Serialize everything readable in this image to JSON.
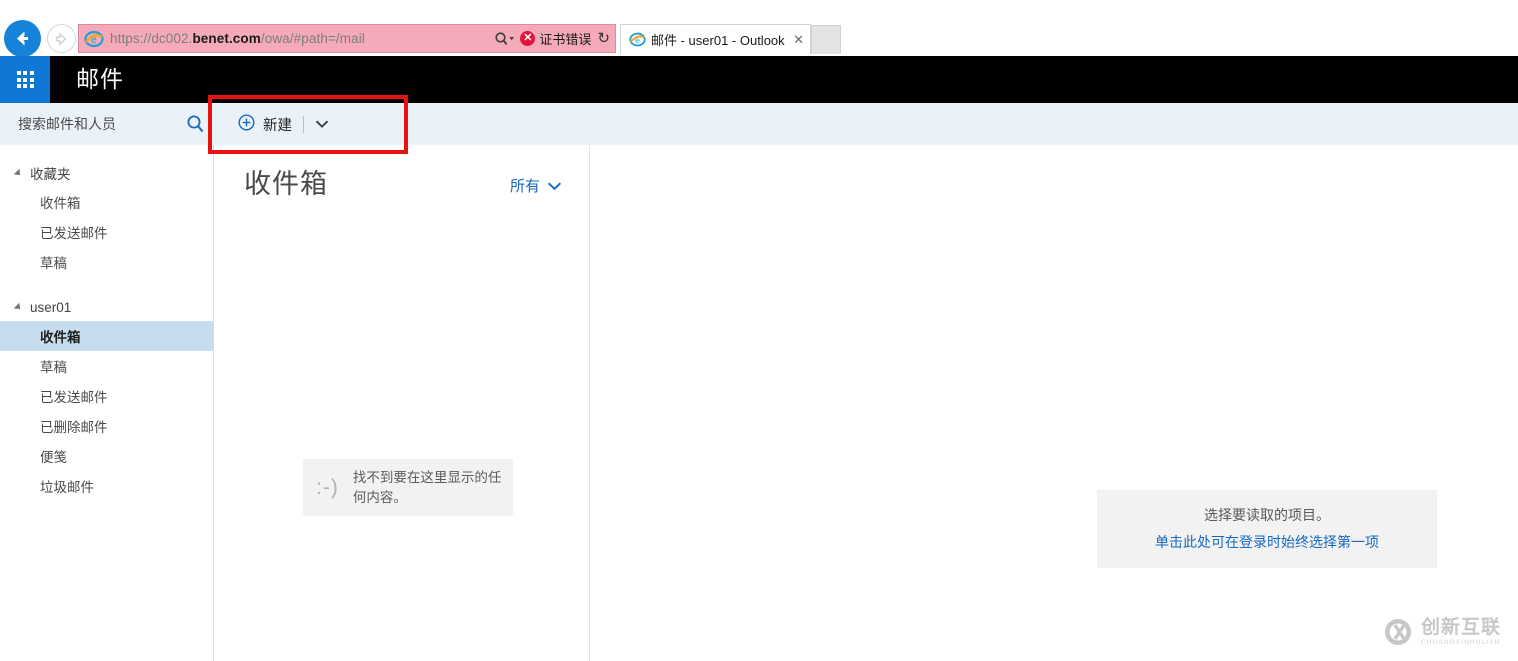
{
  "browser": {
    "back_icon": "back-arrow-icon",
    "forward_icon": "forward-arrow-icon",
    "url": {
      "prefix": "https://dc002.",
      "host": "benet.com",
      "suffix": "/owa/#path=/mail",
      "full": "https://dc002.benet.com/owa/#path=/mail"
    },
    "favicon": "internet-explorer-icon",
    "search_dropdown_icon": "search-dropdown-icon",
    "cert_error": {
      "icon": "error-badge-icon",
      "label": "证书错误"
    },
    "refresh_icon": "refresh-icon",
    "refresh_glyph": "↻",
    "tab": {
      "favicon": "internet-explorer-icon",
      "title": "邮件 - user01 - Outlook",
      "close_icon": "close-icon",
      "close_glyph": "✕"
    },
    "new_tab_label": ""
  },
  "header": {
    "app_launcher_icon": "waffle-grid-icon",
    "title": "邮件",
    "background": "#000000",
    "launcher_color": "#0f78d4"
  },
  "search": {
    "placeholder": "搜索邮件和人员",
    "value": "",
    "icon": "search-icon"
  },
  "toolbar": {
    "new_button": {
      "icon": "circle-plus-icon",
      "label": "新建",
      "chevron_icon": "chevron-down-icon"
    }
  },
  "sidebar": {
    "groups": [
      {
        "label": "收藏夹",
        "caret_icon": "caret-down-icon",
        "items": [
          {
            "label": "收件箱",
            "selected": false
          },
          {
            "label": "已发送邮件",
            "selected": false
          },
          {
            "label": "草稿",
            "selected": false
          }
        ]
      },
      {
        "label": "user01",
        "caret_icon": "caret-down-icon",
        "items": [
          {
            "label": "收件箱",
            "selected": true
          },
          {
            "label": "草稿",
            "selected": false
          },
          {
            "label": "已发送邮件",
            "selected": false
          },
          {
            "label": "已删除邮件",
            "selected": false
          },
          {
            "label": "便笺",
            "selected": false
          },
          {
            "label": "垃圾邮件",
            "selected": false
          }
        ]
      }
    ],
    "selected_background": "#c7dcee"
  },
  "message_list": {
    "title": "收件箱",
    "filter": {
      "label": "所有",
      "chevron_icon": "chevron-down-icon"
    },
    "empty_state": {
      "smiley": ":-)",
      "message": "找不到要在这里显示的任何内容。"
    }
  },
  "reading_pane": {
    "placeholder_text": "选择要读取的项目。",
    "placeholder_link": "单击此处可在登录时始终选择第一项",
    "link_color": "#1668c1"
  },
  "watermark": {
    "logo_icon": "cx-circle-logo-icon",
    "cn_text": "创新互联",
    "en_text": "CHUANGXINHULIAN"
  },
  "annotation": {
    "color": "#e8110f",
    "target": "新建"
  }
}
